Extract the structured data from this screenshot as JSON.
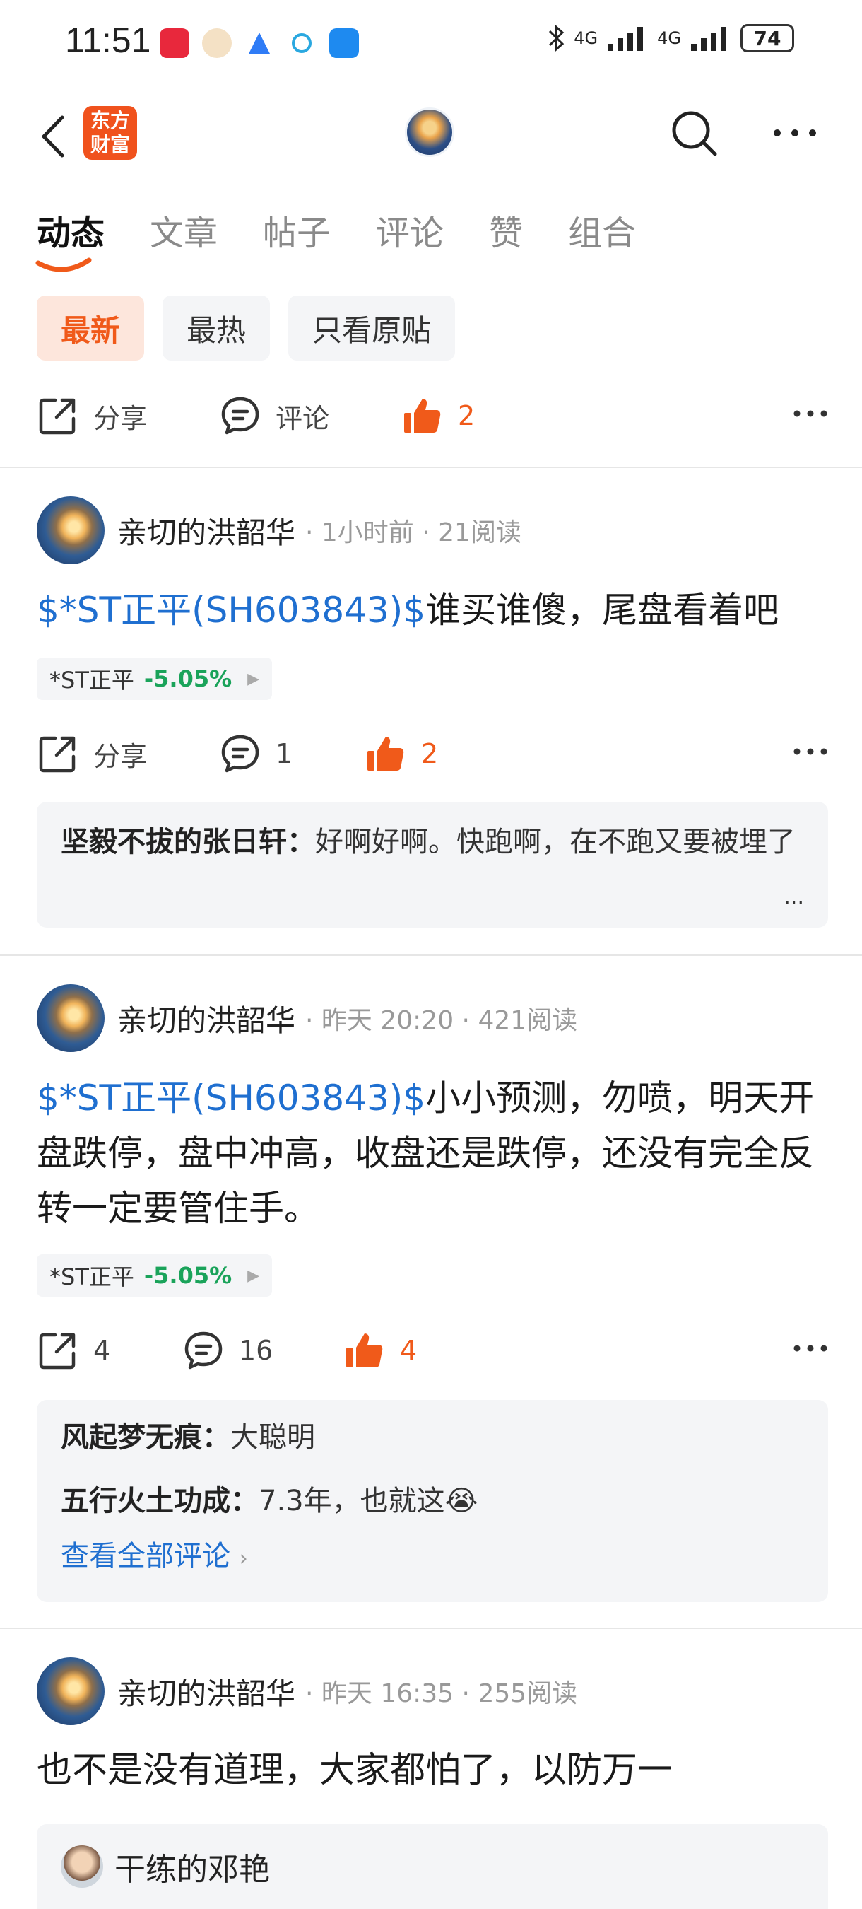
{
  "status_bar": {
    "time": "11:51",
    "battery": "74",
    "network_1": "4G",
    "network_2": "4G"
  },
  "header": {
    "logo_line1": "东方",
    "logo_line2": "财富"
  },
  "tabs": [
    {
      "label": "动态",
      "active": true
    },
    {
      "label": "文章",
      "active": false
    },
    {
      "label": "帖子",
      "active": false
    },
    {
      "label": "评论",
      "active": false
    },
    {
      "label": "赞",
      "active": false
    },
    {
      "label": "组合",
      "active": false
    }
  ],
  "filters": [
    {
      "label": "最新",
      "active": true
    },
    {
      "label": "最热",
      "active": false
    },
    {
      "label": "只看原贴",
      "active": false
    }
  ],
  "top_actions": {
    "share_label": "分享",
    "comment_label": "评论",
    "like_count": "2"
  },
  "posts": [
    {
      "author": "亲切的洪韶华",
      "time": "1小时前",
      "reads": "21阅读",
      "stock_link": "$*ST正平(SH603843)$",
      "text": "谁买谁傻，尾盘看着吧",
      "stock_tag_name": "*ST正平",
      "stock_tag_change": "-5.05%",
      "share": "分享",
      "comments": "1",
      "likes": "2",
      "replies": [
        {
          "user": "坚毅不拔的张日轩",
          "text": "好啊好啊。快跑啊，在不跑又要被埋了"
        }
      ],
      "ellipsis": "..."
    },
    {
      "author": "亲切的洪韶华",
      "time": "昨天 20:20",
      "reads": "421阅读",
      "stock_link": "$*ST正平(SH603843)$",
      "text": "小小预测，勿喷，明天开盘跌停，盘中冲高，收盘还是跌停，还没有完全反转一定要管住手。",
      "stock_tag_name": "*ST正平",
      "stock_tag_change": "-5.05%",
      "share": "4",
      "comments": "16",
      "likes": "4",
      "replies": [
        {
          "user": "风起梦无痕",
          "text": "大聪明"
        },
        {
          "user": "五行火土功成",
          "text": "7.3年，也就这😭"
        }
      ],
      "view_all": "查看全部评论"
    },
    {
      "author": "亲切的洪韶华",
      "time": "昨天 16:35",
      "reads": "255阅读",
      "text": "也不是没有道理，大家都怕了，以防万一",
      "quoted_user": "干练的邓艳"
    }
  ],
  "colors": {
    "accent": "#f05a1a",
    "link": "#1f6fd0",
    "down": "#1aa35a"
  }
}
